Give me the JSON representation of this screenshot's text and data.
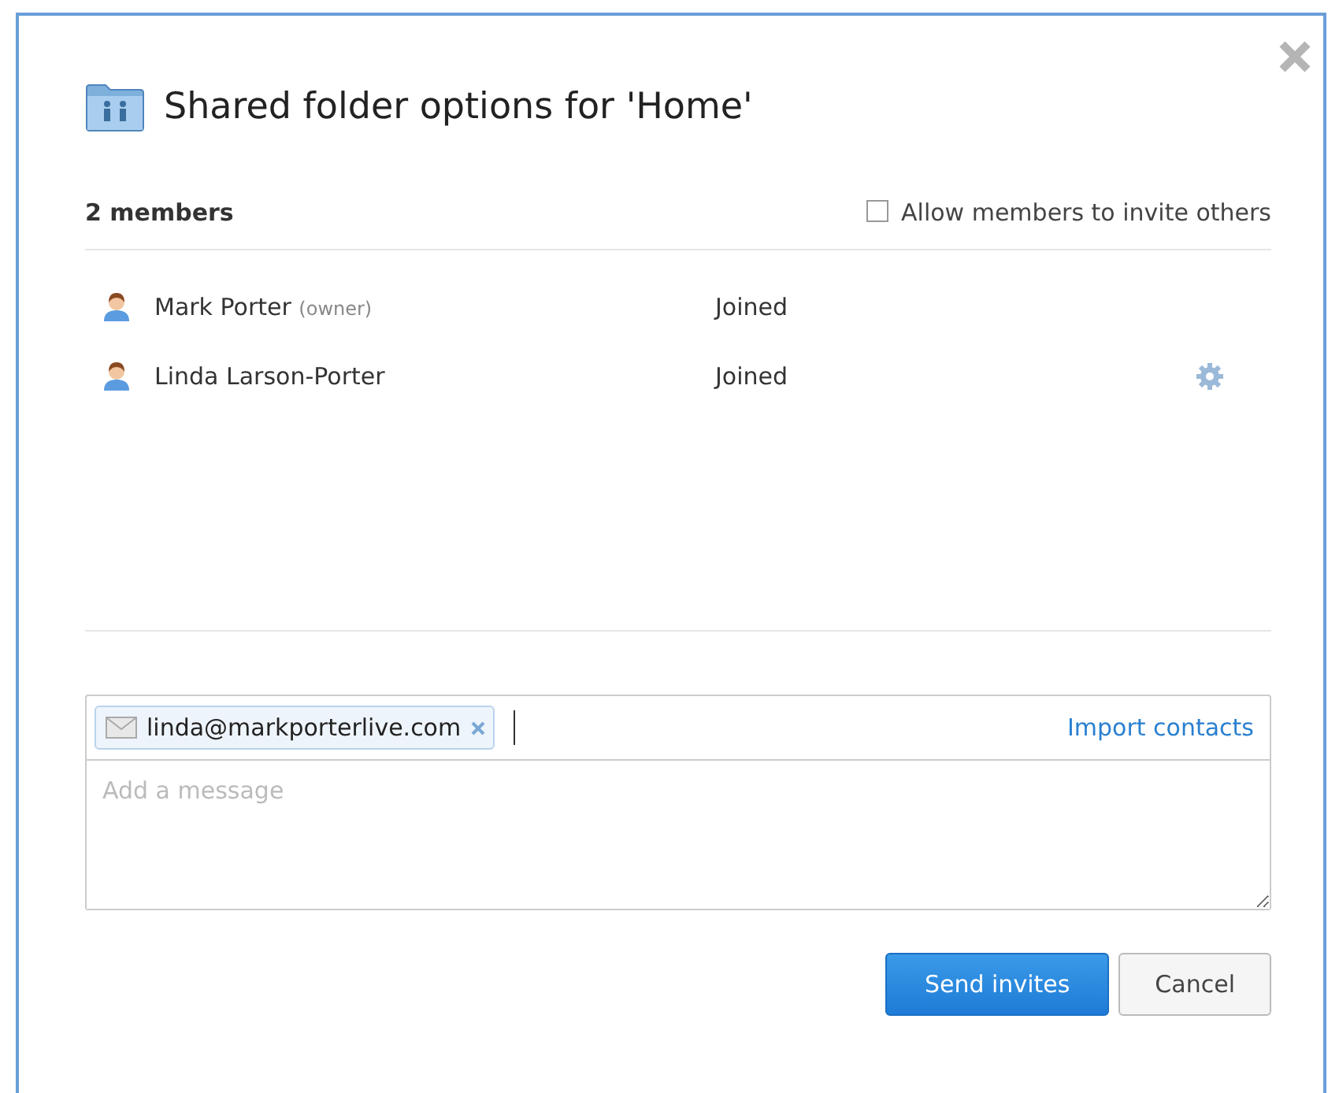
{
  "dialog": {
    "title": "Shared folder options for 'Home'"
  },
  "members_count": "2 members",
  "allow_invite": {
    "label": "Allow members to invite others",
    "checked": false
  },
  "members": [
    {
      "name": "Mark Porter",
      "note": "(owner)",
      "status": "Joined",
      "settings": false
    },
    {
      "name": "Linda Larson-Porter",
      "status": "Joined",
      "settings": true
    }
  ],
  "invite": {
    "tokens": [
      "linda@markporterlive.com"
    ],
    "import_link": "Import contacts",
    "message_placeholder": "Add a message"
  },
  "buttons": {
    "primary": "Send invites",
    "secondary": "Cancel"
  }
}
